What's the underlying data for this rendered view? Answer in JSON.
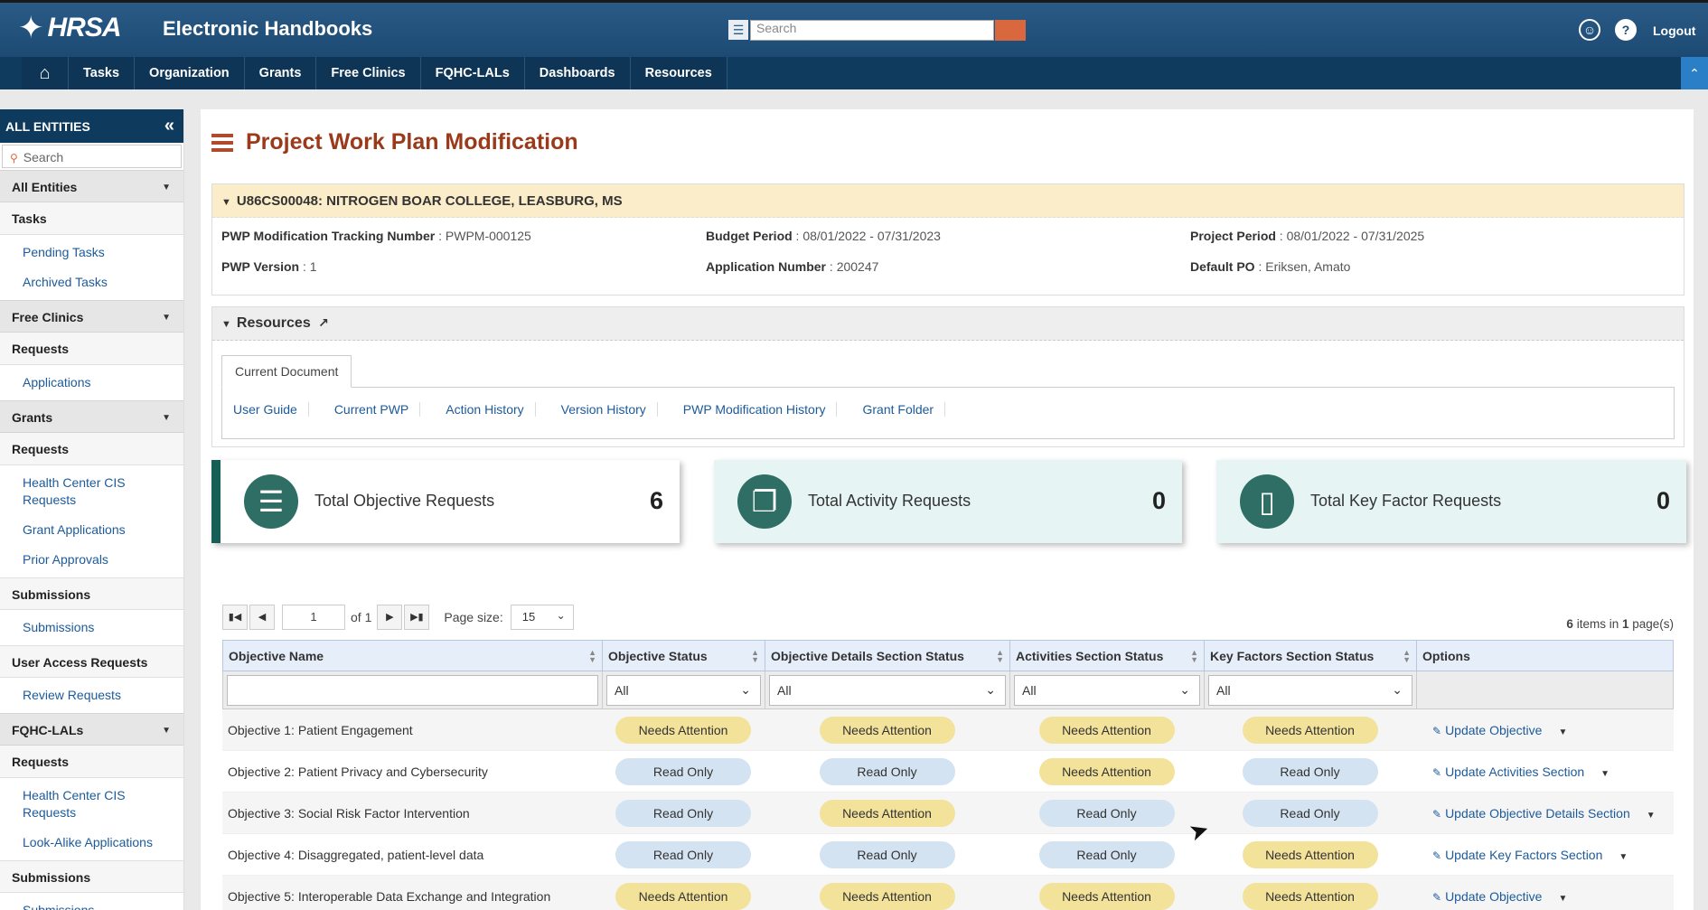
{
  "header": {
    "logo_text": "HRSA",
    "app_title": "Electronic Handbooks",
    "search_placeholder": "Search",
    "logout": "Logout"
  },
  "nav": {
    "items": [
      "Tasks",
      "Organization",
      "Grants",
      "Free Clinics",
      "FQHC-LALs",
      "Dashboards",
      "Resources"
    ]
  },
  "sidebar": {
    "title": "ALL ENTITIES",
    "search_placeholder": "Search",
    "sections": [
      {
        "group": "All Entities",
        "sub": "Tasks",
        "links": [
          "Pending Tasks",
          "Archived Tasks"
        ]
      },
      {
        "group": "Free Clinics",
        "sub": "Requests",
        "links": [
          "Applications"
        ]
      },
      {
        "group": "Grants",
        "sub": "Requests",
        "links": [
          "Health Center CIS Requests",
          "Grant Applications",
          "Prior Approvals"
        ]
      },
      {
        "sub": "Submissions",
        "links": [
          "Submissions"
        ]
      },
      {
        "sub": "User Access Requests",
        "links": [
          "Review Requests"
        ]
      },
      {
        "group": "FQHC-LALs",
        "sub": "Requests",
        "links": [
          "Health Center CIS Requests",
          "Look-Alike Applications"
        ]
      },
      {
        "sub": "Submissions",
        "links": [
          "Submissions"
        ]
      }
    ]
  },
  "page": {
    "title": "Project Work Plan Modification",
    "grant_header": "U86CS00048: NITROGEN BOAR COLLEGE, LEASBURG, MS",
    "fields": {
      "tracking_label": "PWP Modification Tracking Number",
      "tracking_value": "PWPM-000125",
      "budget_label": "Budget Period",
      "budget_value": "08/01/2022 - 07/31/2023",
      "project_label": "Project Period",
      "project_value": "08/01/2022 - 07/31/2025",
      "version_label": "PWP Version",
      "version_value": "1",
      "application_label": "Application Number",
      "application_value": "200247",
      "po_label": "Default PO",
      "po_value": "Eriksen, Amato"
    },
    "resources": {
      "title": "Resources",
      "tab": "Current Document",
      "links": [
        "User Guide",
        "Current PWP",
        "Action History",
        "Version History",
        "PWP Modification History",
        "Grant Folder"
      ]
    },
    "cards": [
      {
        "label": "Total Objective Requests",
        "value": "6",
        "icon": "list-icon"
      },
      {
        "label": "Total Activity Requests",
        "value": "0",
        "icon": "documents-icon"
      },
      {
        "label": "Total Key Factor Requests",
        "value": "0",
        "icon": "file-icon"
      }
    ]
  },
  "grid": {
    "pager": {
      "page": "1",
      "of": "of 1",
      "page_size_label": "Page size:",
      "page_size": "15",
      "count_num": "6",
      "count_mid": " items in ",
      "count_pages": "1",
      "count_end": " page(s)"
    },
    "columns": [
      "Objective Name",
      "Objective Status",
      "Objective Details Section Status",
      "Activities Section Status",
      "Key Factors Section Status",
      "Options"
    ],
    "filter_all": "All",
    "rows": [
      {
        "name": "Objective 1: Patient Engagement",
        "s1": "Needs Attention",
        "s2": "Needs Attention",
        "s3": "Needs Attention",
        "s4": "Needs Attention",
        "option": "Update Objective"
      },
      {
        "name": "Objective 2: Patient Privacy and Cybersecurity",
        "s1": "Read Only",
        "s2": "Read Only",
        "s3": "Needs Attention",
        "s4": "Read Only",
        "option": "Update Activities Section"
      },
      {
        "name": "Objective 3: Social Risk Factor Intervention",
        "s1": "Read Only",
        "s2": "Needs Attention",
        "s3": "Read Only",
        "s4": "Read Only",
        "option": "Update Objective Details Section"
      },
      {
        "name": "Objective 4: Disaggregated, patient-level data",
        "s1": "Read Only",
        "s2": "Read Only",
        "s3": "Read Only",
        "s4": "Needs Attention",
        "option": "Update Key Factors Section"
      },
      {
        "name": "Objective 5: Interoperable Data Exchange and Integration",
        "s1": "Needs Attention",
        "s2": "Needs Attention",
        "s3": "Needs Attention",
        "s4": "Needs Attention",
        "option": "Update Objective"
      }
    ]
  },
  "colors": {
    "header_bg": "#1c4a73",
    "nav_bg": "#0f3b5f",
    "title_color": "#9b3a1a",
    "needs_attention": "#f3e29a",
    "read_only": "#d4e3f1",
    "card_icon": "#2e6e64"
  }
}
